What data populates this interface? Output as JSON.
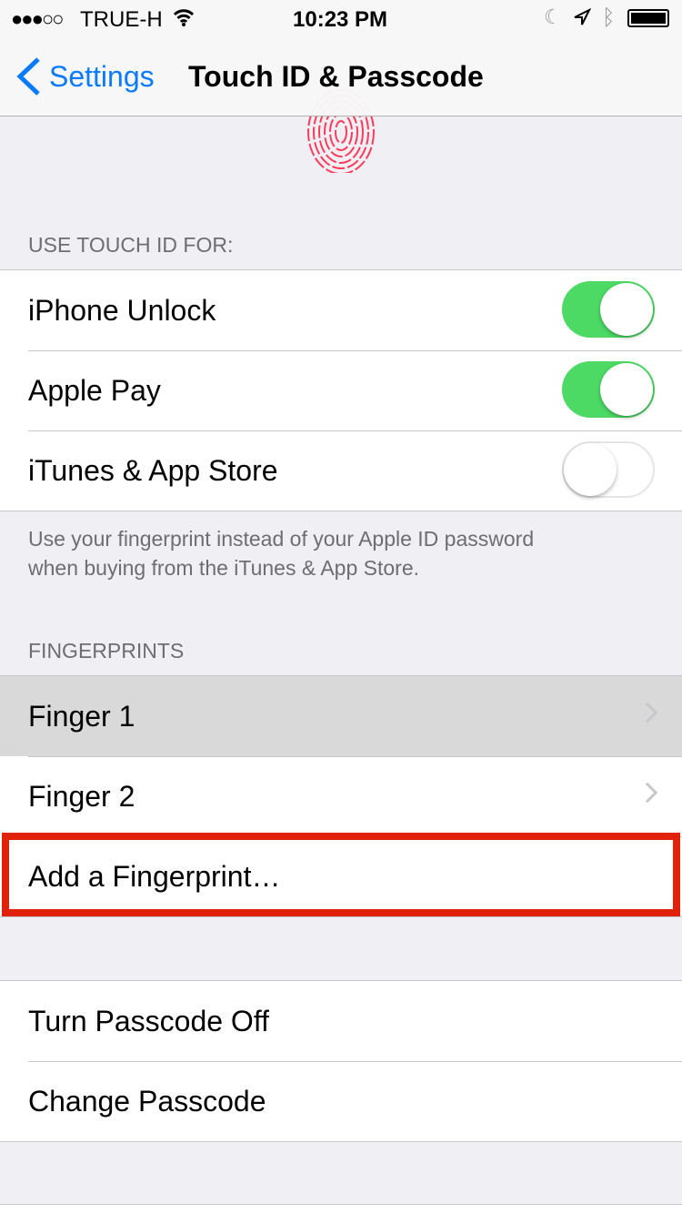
{
  "status_bar": {
    "carrier": "TRUE-H",
    "signal_dots": "●●●○○",
    "time": "10:23 PM"
  },
  "nav": {
    "back_label": "Settings",
    "title": "Touch ID & Passcode"
  },
  "touch_id": {
    "header": "USE TOUCH ID FOR:",
    "items": [
      {
        "label": "iPhone Unlock",
        "on": true
      },
      {
        "label": "Apple Pay",
        "on": true
      },
      {
        "label": "iTunes & App Store",
        "on": false
      }
    ],
    "footer_line1": "Use your fingerprint instead of your Apple ID password",
    "footer_line2": "when buying from the iTunes & App Store."
  },
  "fingerprints": {
    "header": "FINGERPRINTS",
    "items": [
      {
        "label": "Finger 1"
      },
      {
        "label": "Finger 2"
      }
    ],
    "add_label": "Add a Fingerprint…"
  },
  "passcode": {
    "items": [
      {
        "label": "Turn Passcode Off"
      },
      {
        "label": "Change Passcode"
      }
    ]
  },
  "colors": {
    "accent": "#0a7aff",
    "toggle_on": "#4cd964",
    "highlight_box": "#e0220a",
    "fingerprint": "#ff3b5c"
  }
}
